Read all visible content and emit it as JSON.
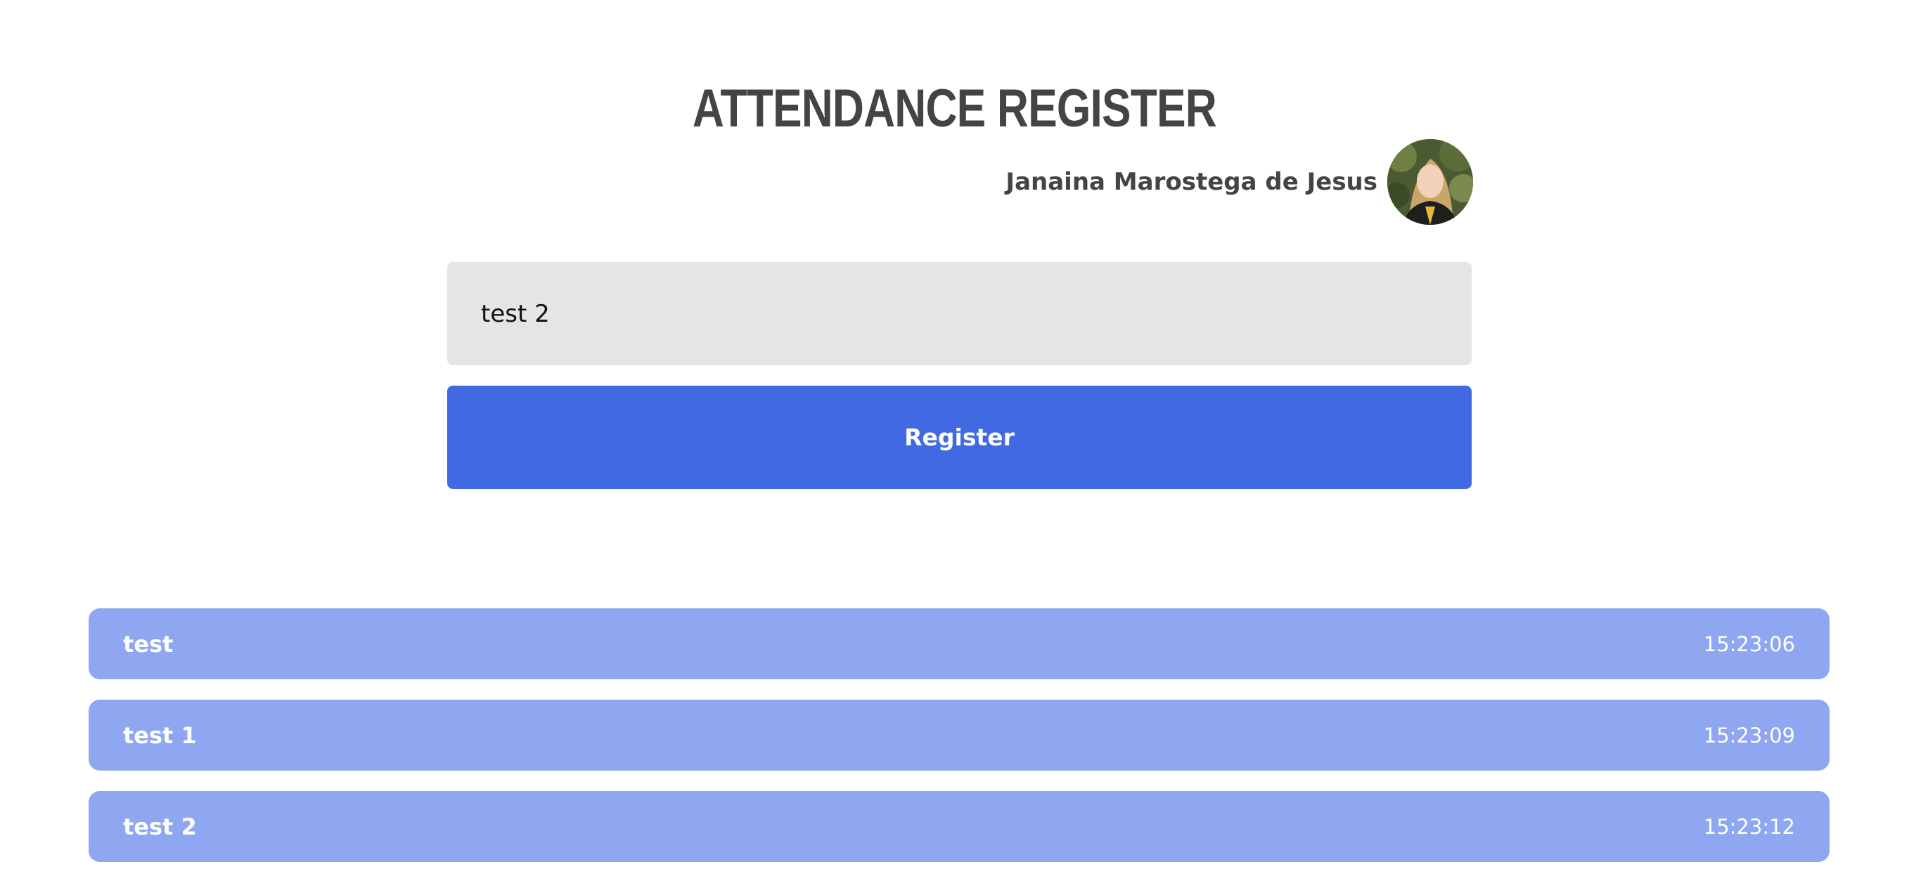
{
  "header": {
    "title": "ATTENDANCE REGISTER",
    "user_name": "Janaina Marostega de Jesus"
  },
  "form": {
    "input_value": "test 2",
    "register_label": "Register"
  },
  "attendance": [
    {
      "name": "test",
      "time": "15:23:06"
    },
    {
      "name": "test 1",
      "time": "15:23:09"
    },
    {
      "name": "test 2",
      "time": "15:23:12"
    }
  ],
  "colors": {
    "primary": "#4169e1",
    "row_background": "#8fa7f0",
    "input_background": "#e5e5e5",
    "text_dark": "#444444"
  }
}
